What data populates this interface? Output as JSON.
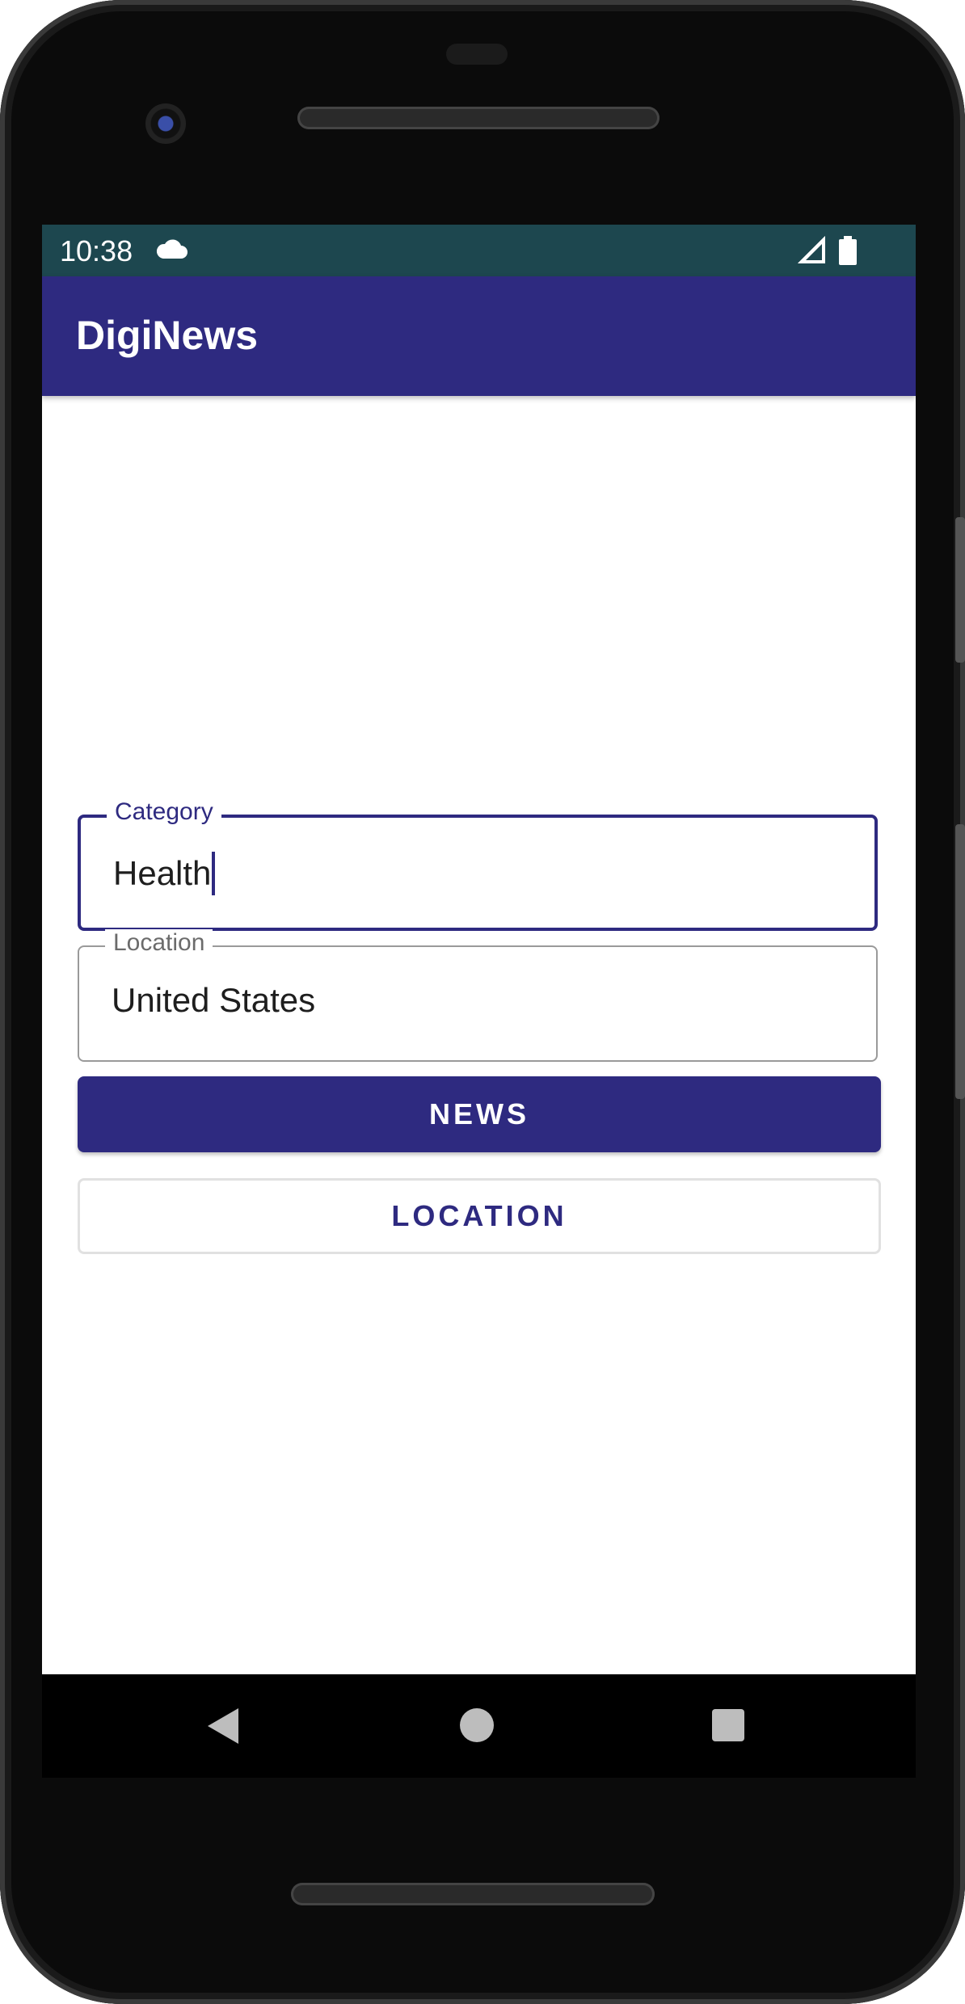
{
  "status_bar": {
    "time": "10:38",
    "icons": [
      "cloud-icon",
      "cell-signal-icon",
      "battery-icon"
    ]
  },
  "app_bar": {
    "title": "DigiNews"
  },
  "form": {
    "category": {
      "label": "Category",
      "value": "Health"
    },
    "location": {
      "label": "Location",
      "value": "United States"
    }
  },
  "buttons": {
    "news": "NEWS",
    "location": "LOCATION"
  },
  "nav": {
    "icons": [
      "back-icon",
      "home-icon",
      "recents-icon"
    ]
  },
  "colors": {
    "primary": "#2e2a80",
    "status_bar": "#1d474f",
    "outline": "#9a9a9a"
  }
}
